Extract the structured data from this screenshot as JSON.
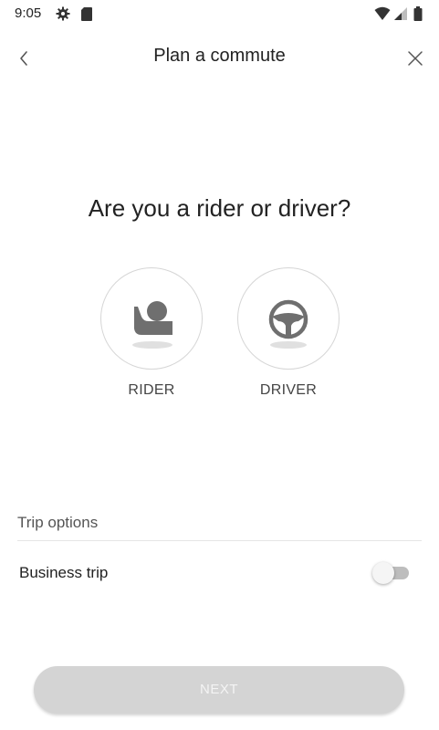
{
  "status_bar": {
    "time": "9:05",
    "icons": [
      "gear-icon",
      "sd-card-icon",
      "wifi-icon",
      "signal-icon",
      "battery-icon"
    ]
  },
  "header": {
    "title": "Plan a commute",
    "back_icon": "chevron-left-icon",
    "close_icon": "close-icon"
  },
  "question": "Are you a rider or driver?",
  "choices": [
    {
      "label": "RIDER",
      "icon": "rider-seat-icon"
    },
    {
      "label": "DRIVER",
      "icon": "steering-wheel-icon"
    }
  ],
  "trip_options": {
    "section_label": "Trip options",
    "business_trip_label": "Business trip",
    "business_trip_enabled": false
  },
  "next_button": {
    "label": "NEXT",
    "enabled": false
  },
  "colors": {
    "icon_gray": "#6f6f6f",
    "circle_border": "#d6d6d6",
    "button_disabled": "#d4d4d4"
  }
}
